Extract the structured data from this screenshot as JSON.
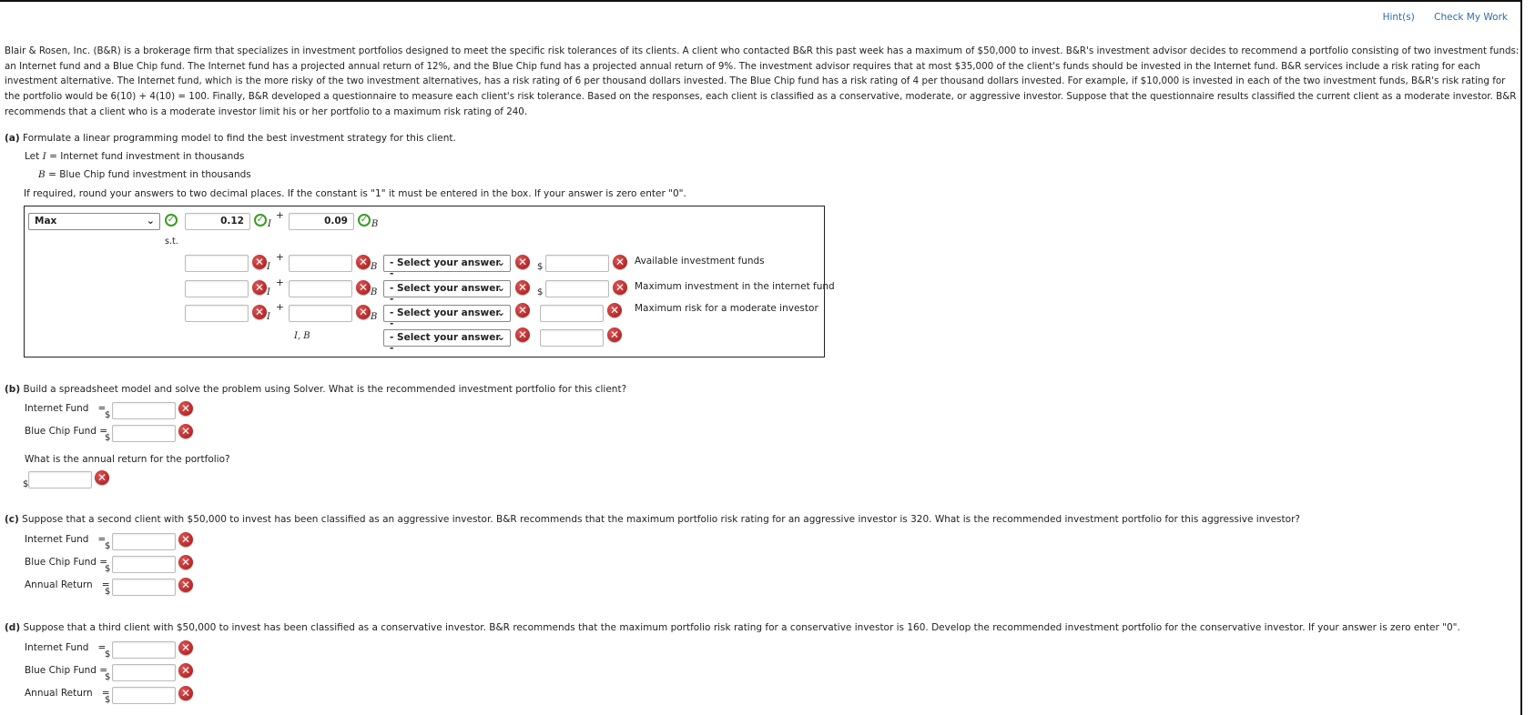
{
  "toolbar": {
    "hints": "Hint(s)",
    "check": "Check My Work"
  },
  "intro": "Blair & Rosen, Inc. (B&R) is a brokerage firm that specializes in investment portfolios designed to meet the specific risk tolerances of its clients. A client who contacted B&R this past week has a maximum of $50,000 to invest. B&R's investment advisor decides to recommend a portfolio consisting of two investment funds: an Internet fund and a Blue Chip fund. The Internet fund has a projected annual return of 12%, and the Blue Chip fund has a projected annual return of 9%. The investment advisor requires that at most $35,000 of the client's funds should be invested in the Internet fund. B&R services include a risk rating for each investment alternative. The Internet fund, which is the more risky of the two investment alternatives, has a risk rating of 6 per thousand dollars invested. The Blue Chip fund has a risk rating of 4 per thousand dollars invested. For example, if $10,000 is invested in each of the two investment funds, B&R's risk rating for the portfolio would be 6(10) + 4(10) = 100. Finally, B&R developed a questionnaire to measure each client's risk tolerance. Based on the responses, each client is classified as a conservative, moderate, or aggressive investor. Suppose that the questionnaire results classified the current client as a moderate investor. B&R recommends that a client who is a moderate investor limit his or her portfolio to a maximum risk rating of 240.",
  "partA": {
    "label": "(a)",
    "question": "Formulate a linear programming model to find the best investment strategy for this client.",
    "let_prefix": "Let",
    "var_i": "I",
    "var_i_def": "= Internet fund investment in thousands",
    "var_b": "B",
    "var_b_def": "= Blue Chip fund investment in thousands",
    "instructions": "If required, round your answers to two decimal places. If the constant is \"1\" it must be entered in the box. If your answer is zero enter \"0\".",
    "objective": {
      "type": "Max",
      "coef_i": "0.12",
      "coef_b": "0.09"
    },
    "st": "s.t.",
    "plus": "+",
    "sub_i": "I",
    "sub_b": "B",
    "select_placeholder": "- Select your answer -",
    "dollar": "$",
    "constraints": [
      {
        "coef_i": "",
        "coef_b": "",
        "rhs": "",
        "label": "Available investment funds"
      },
      {
        "coef_i": "",
        "coef_b": "",
        "rhs": "",
        "label": "Maximum investment in the internet fund"
      },
      {
        "coef_i": "",
        "coef_b": "",
        "rhs": "",
        "label": "Maximum risk for a moderate investor"
      }
    ],
    "nonneg_vars": "I, B"
  },
  "partB": {
    "label": "(b)",
    "question": "Build a spreadsheet model and solve the problem using Solver. What is the recommended investment portfolio for this client?",
    "internet_label": "Internet Fund   =",
    "bluechip_label": "Blue Chip Fund =",
    "return_question": "What is the annual return for the portfolio?",
    "internet_value": "",
    "bluechip_value": "",
    "return_value": ""
  },
  "partC": {
    "label": "(c)",
    "question": "Suppose that a second client with $50,000 to invest has been classified as an aggressive investor. B&R recommends that the maximum portfolio risk rating for an aggressive investor is 320. What is the recommended investment portfolio for this aggressive investor?",
    "internet_label": "Internet Fund   =",
    "bluechip_label": "Blue Chip Fund =",
    "return_label": "Annual Return   ="
  },
  "partD": {
    "label": "(d)",
    "question": "Suppose that a third client with $50,000 to invest has been classified as a conservative investor. B&R recommends that the maximum portfolio risk rating for a conservative investor is 160. Develop the recommended investment portfolio for the conservative investor. If your answer is zero enter \"0\".",
    "internet_label": "Internet Fund   =",
    "bluechip_label": "Blue Chip Fund =",
    "return_label": "Annual Return   ="
  },
  "icons": {
    "correct": "✓",
    "incorrect": "✕",
    "chevron": "⌄"
  }
}
